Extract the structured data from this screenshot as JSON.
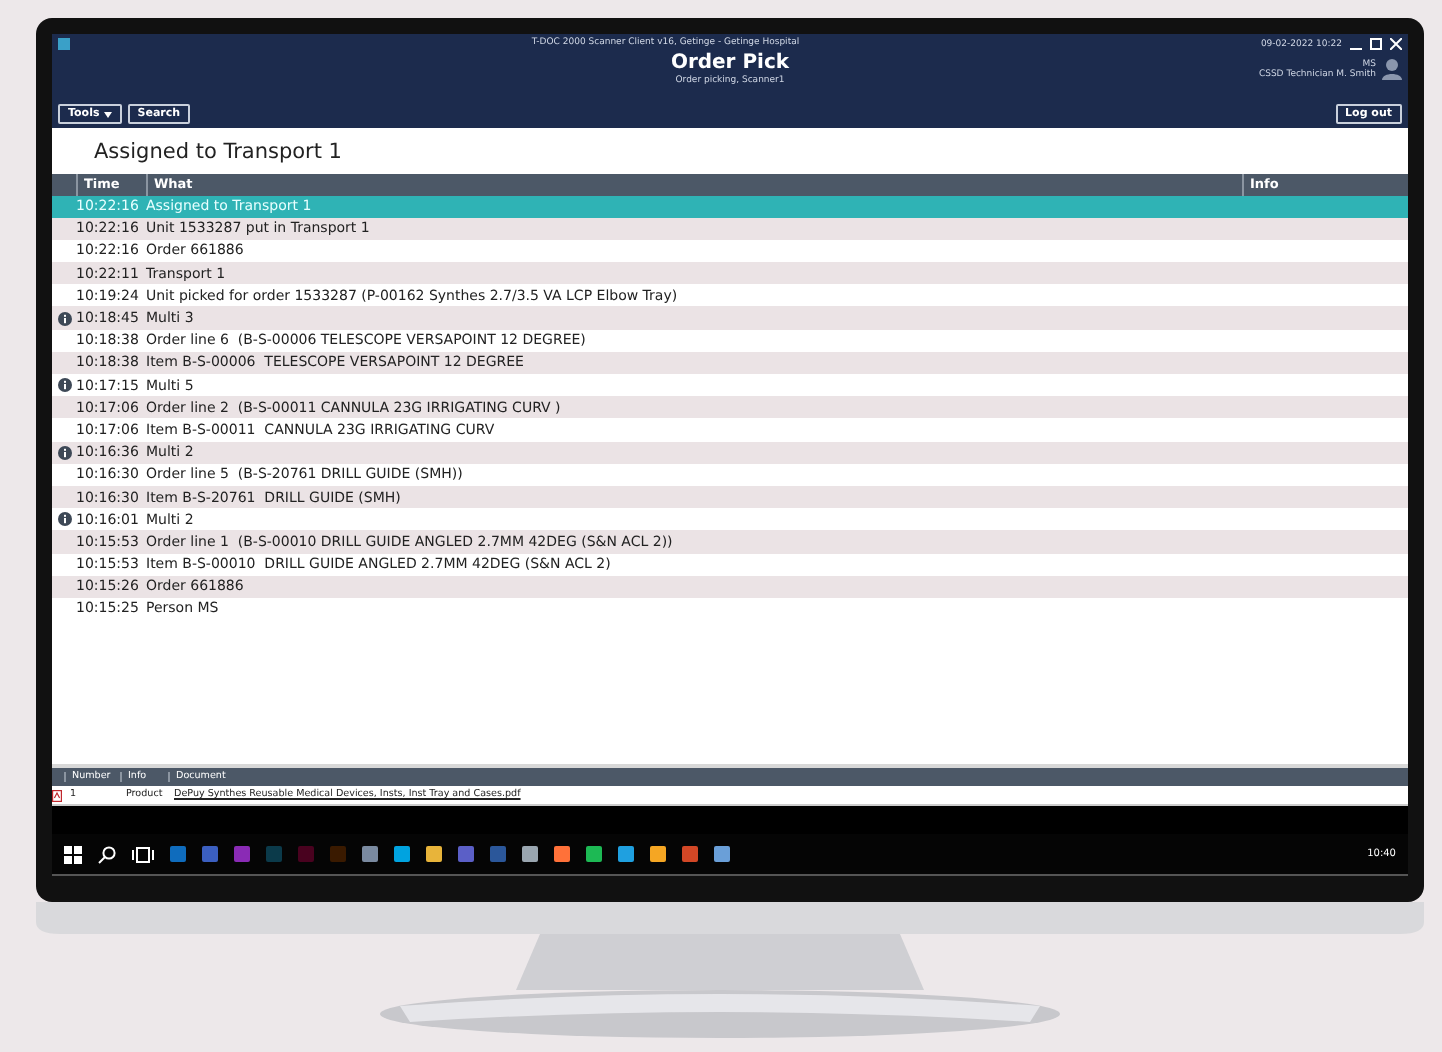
{
  "window": {
    "title": "T-DOC 2000 Scanner Client v16, Getinge - Getinge Hospital",
    "datetime": "09-02-2022 10:22"
  },
  "header": {
    "title": "Order Pick",
    "subtitle": "Order picking, Scanner1",
    "user_initials": "MS",
    "user_name": "CSSD Technician M. Smith"
  },
  "toolbar": {
    "buttons": [
      {
        "label": "Tools",
        "dropdown": true
      },
      {
        "label": "Search",
        "dropdown": false
      }
    ],
    "logout": "Log out"
  },
  "heading": "Assigned to Transport 1",
  "table": {
    "columns": [
      "Time",
      "What",
      "Info"
    ],
    "rows": [
      {
        "time": "10:22:16",
        "what": "Assigned to Transport 1",
        "info": false,
        "selected": true
      },
      {
        "time": "10:22:16",
        "what": "Unit 1533287 put in Transport 1",
        "info": false,
        "selected": false
      },
      {
        "time": "10:22:16",
        "what": "Order 661886",
        "info": false,
        "selected": false
      },
      {
        "time": "10:22:11",
        "what": "Transport 1",
        "info": false,
        "selected": false
      },
      {
        "time": "10:19:24",
        "what": "Unit picked for order 1533287 (P-00162 Synthes 2.7/3.5 VA LCP Elbow Tray)",
        "info": false,
        "selected": false
      },
      {
        "time": "10:18:45",
        "what": "Multi 3",
        "info": true,
        "selected": false
      },
      {
        "time": "10:18:38",
        "what": "Order line 6  (B-S-00006 TELESCOPE VERSAPOINT 12 DEGREE)",
        "info": false,
        "selected": false
      },
      {
        "time": "10:18:38",
        "what": "Item B-S-00006  TELESCOPE VERSAPOINT 12 DEGREE",
        "info": false,
        "selected": false
      },
      {
        "time": "10:17:15",
        "what": "Multi 5",
        "info": true,
        "selected": false
      },
      {
        "time": "10:17:06",
        "what": "Order line 2  (B-S-00011 CANNULA 23G IRRIGATING CURV )",
        "info": false,
        "selected": false
      },
      {
        "time": "10:17:06",
        "what": "Item B-S-00011  CANNULA 23G IRRIGATING CURV",
        "info": false,
        "selected": false
      },
      {
        "time": "10:16:36",
        "what": "Multi 2",
        "info": true,
        "selected": false
      },
      {
        "time": "10:16:30",
        "what": "Order line 5  (B-S-20761 DRILL GUIDE (SMH))",
        "info": false,
        "selected": false
      },
      {
        "time": "10:16:30",
        "what": "Item B-S-20761  DRILL GUIDE (SMH)",
        "info": false,
        "selected": false
      },
      {
        "time": "10:16:01",
        "what": "Multi 2",
        "info": true,
        "selected": false
      },
      {
        "time": "10:15:53",
        "what": "Order line 1  (B-S-00010 DRILL GUIDE ANGLED 2.7MM 42DEG (S&N ACL 2))",
        "info": false,
        "selected": false
      },
      {
        "time": "10:15:53",
        "what": "Item B-S-00010  DRILL GUIDE ANGLED 2.7MM 42DEG (S&N ACL 2)",
        "info": false,
        "selected": false
      },
      {
        "time": "10:15:26",
        "what": "Order 661886",
        "info": false,
        "selected": false
      },
      {
        "time": "10:15:25",
        "what": "Person MS",
        "info": false,
        "selected": false
      }
    ]
  },
  "documents": {
    "columns": [
      "Number",
      "Info",
      "Document"
    ],
    "rows": [
      {
        "number": "1",
        "info": "Product",
        "document": "DePuy Synthes Reusable Medical Devices, Insts, Inst Tray and Cases.pdf"
      }
    ]
  },
  "taskbar": {
    "apps": [
      {
        "color": "#0f6cbd"
      },
      {
        "color": "#3b5fc0"
      },
      {
        "color": "#8a2bb5"
      },
      {
        "color": "#0b3a4a"
      },
      {
        "color": "#49021f"
      },
      {
        "color": "#3a1a00"
      },
      {
        "color": "#7a8aa0"
      },
      {
        "color": "#00a3e0"
      },
      {
        "color": "#e8b43a"
      },
      {
        "color": "#5b5fc7"
      },
      {
        "color": "#2b579a"
      },
      {
        "color": "#9aa6b0"
      },
      {
        "color": "#ff7139"
      },
      {
        "color": "#1db954"
      },
      {
        "color": "#1fa0e0"
      },
      {
        "color": "#f5a623"
      },
      {
        "color": "#d24726"
      },
      {
        "color": "#6a9fd8"
      }
    ],
    "time": "10:40"
  }
}
